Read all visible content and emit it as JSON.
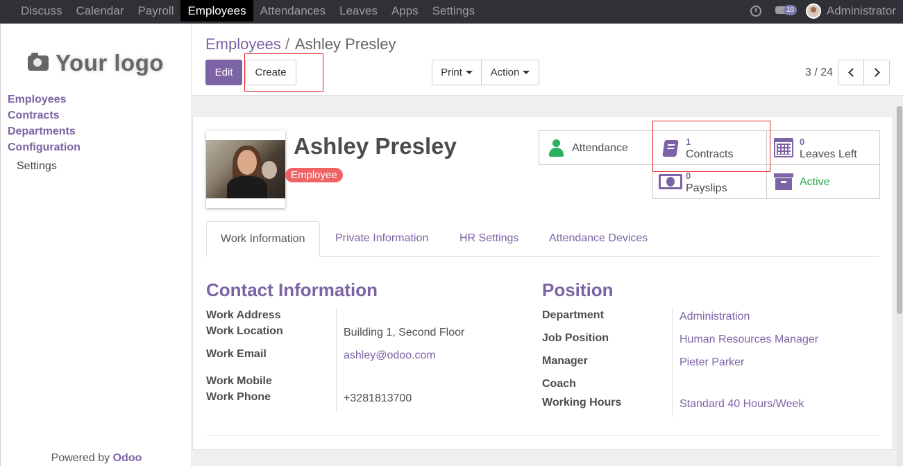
{
  "topbar": {
    "apps": [
      "Discuss",
      "Calendar",
      "Payroll",
      "Employees",
      "Attendances",
      "Leaves",
      "Apps",
      "Settings"
    ],
    "active_app": "Employees",
    "chat_count": "10",
    "user_name": "Administrator",
    "icons": [
      "clock-icon",
      "chat-icon",
      "avatar"
    ]
  },
  "sidebar": {
    "logo_text": "Your logo",
    "menu": [
      "Employees",
      "Contracts",
      "Departments",
      "Configuration"
    ],
    "submenu": [
      "Settings"
    ],
    "powered_prefix": "Powered by",
    "powered_brand": "Odoo"
  },
  "control": {
    "breadcrumb_parent": "Employees",
    "breadcrumb_sep": "/",
    "breadcrumb_current": "Ashley Presley",
    "edit_label": "Edit",
    "create_label": "Create",
    "print_label": "Print",
    "action_label": "Action",
    "pager_text": "3 / 24"
  },
  "employee": {
    "name": "Ashley Presley",
    "tag": "Employee"
  },
  "stats": {
    "attendance": {
      "label": "Attendance"
    },
    "contracts": {
      "count": "1",
      "label": "Contracts"
    },
    "leaves": {
      "count": "0",
      "label": "Leaves Left"
    },
    "payslips": {
      "count": "0",
      "label": "Payslips"
    },
    "active": {
      "label": "Active",
      "color": "#28a745"
    }
  },
  "tabs": [
    "Work Information",
    "Private Information",
    "HR Settings",
    "Attendance Devices"
  ],
  "active_tab": "Work Information",
  "contact": {
    "title": "Contact Information",
    "labels": {
      "work_address": "Work Address",
      "work_location": "Work Location",
      "work_email": "Work Email",
      "work_mobile": "Work Mobile",
      "work_phone": "Work Phone"
    },
    "values": {
      "work_address": "",
      "work_location": "Building 1, Second Floor",
      "work_email": "ashley@odoo.com",
      "work_mobile": "",
      "work_phone": "+3281813700"
    }
  },
  "position": {
    "title": "Position",
    "labels": {
      "department": "Department",
      "job_position": "Job Position",
      "manager": "Manager",
      "coach": "Coach",
      "working_hours": "Working Hours"
    },
    "values": {
      "department": "Administration",
      "job_position": "Human Resources Manager",
      "manager": "Pieter Parker",
      "coach": "",
      "working_hours": "Standard 40 Hours/Week"
    }
  },
  "colors": {
    "brand": "#7c63a5",
    "topbar": "#2f3136",
    "tag": "#f06263",
    "highlight": "#e12020"
  }
}
